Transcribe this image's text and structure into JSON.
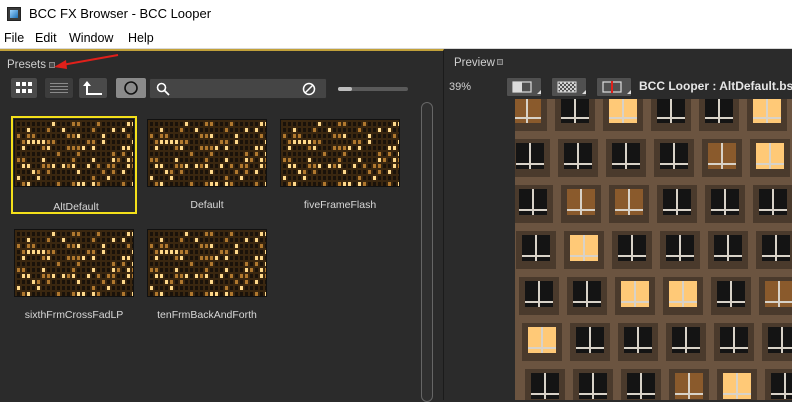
{
  "window": {
    "title": "BCC FX Browser - BCC Looper"
  },
  "menu": [
    "File",
    "Edit",
    "Window",
    "Help"
  ],
  "presets_panel": {
    "title": "Presets",
    "search": {
      "value": "",
      "placeholder": ""
    },
    "thumbnail_size": 0.2,
    "accent_color": "#c2a13a",
    "selected_color": "#f4e01a",
    "items": [
      {
        "label": "AltDefault",
        "selected": true
      },
      {
        "label": "Default",
        "selected": false
      },
      {
        "label": "fiveFrameFlash",
        "selected": false
      },
      {
        "label": "sixthFrmCrossFadLP",
        "selected": false
      },
      {
        "label": "tenFrmBackAndForth",
        "selected": false
      }
    ],
    "toolbar_icons": [
      "grid-view-icon",
      "list-view-icon",
      "up-folder-icon",
      "circle-icon",
      "search-icon",
      "clear-icon"
    ]
  },
  "preview_panel": {
    "title": "Preview",
    "zoom": "39%",
    "title_text": "BCC Looper : AltDefault.bsp",
    "toolbar_icons": [
      "compare-split-icon",
      "checkerboard-icon",
      "split-line-icon"
    ]
  },
  "annotation": {
    "type": "red-arrow",
    "color": "#e0201a"
  }
}
